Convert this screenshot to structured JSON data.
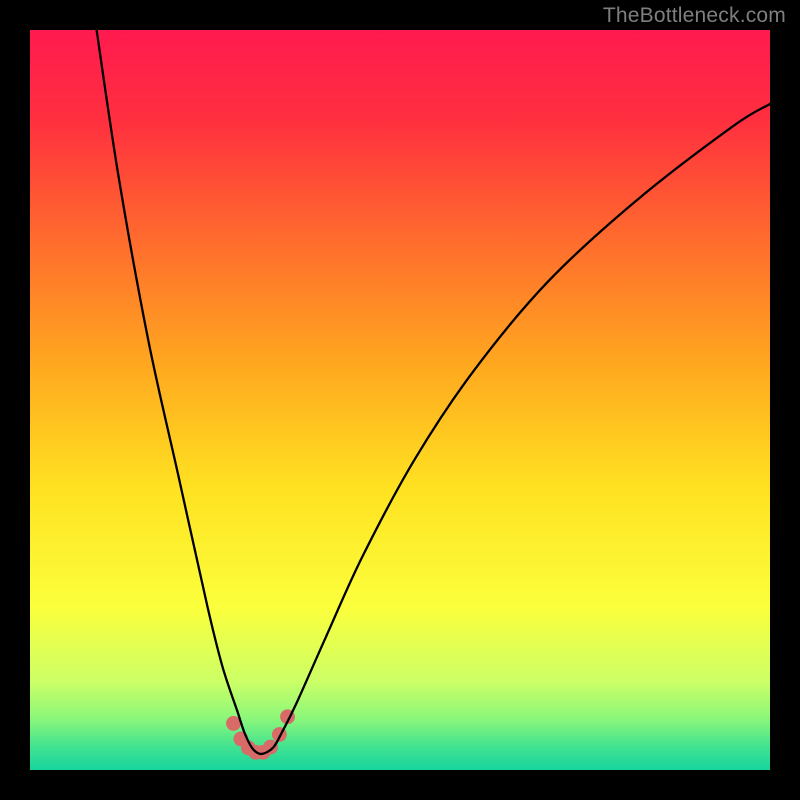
{
  "watermark": "TheBottleneck.com",
  "chart_data": {
    "type": "line",
    "title": "",
    "xlabel": "",
    "ylabel": "",
    "xlim": [
      0,
      100
    ],
    "ylim": [
      0,
      100
    ],
    "grid": false,
    "series": [
      {
        "name": "curve",
        "x": [
          9,
          12,
          16,
          20,
          24,
          26,
          28,
          29,
          30,
          31,
          32,
          33,
          34,
          36,
          40,
          45,
          52,
          60,
          70,
          82,
          95,
          100
        ],
        "y": [
          100,
          80,
          58,
          40,
          22,
          14,
          8,
          5,
          3,
          2.2,
          2.4,
          3.2,
          5,
          9,
          18,
          29,
          42,
          54,
          66,
          77,
          87,
          90
        ],
        "color": "#000000"
      }
    ],
    "bottom_dots": {
      "x": [
        27.5,
        28.5,
        29.5,
        30.5,
        31.5,
        32.5,
        33.7,
        34.8
      ],
      "y": [
        6.3,
        4.2,
        3.0,
        2.4,
        2.4,
        3.1,
        4.8,
        7.2
      ],
      "color": "#d86a67",
      "radius_pct": 1.0
    },
    "background_gradient": {
      "stops": [
        {
          "offset": 0.0,
          "color": "#ff1a4f"
        },
        {
          "offset": 0.12,
          "color": "#ff2f3f"
        },
        {
          "offset": 0.28,
          "color": "#ff6a2e"
        },
        {
          "offset": 0.45,
          "color": "#ffa71f"
        },
        {
          "offset": 0.62,
          "color": "#ffe221"
        },
        {
          "offset": 0.78,
          "color": "#fbff3c"
        },
        {
          "offset": 0.88,
          "color": "#ccff66"
        },
        {
          "offset": 0.93,
          "color": "#8cf77a"
        },
        {
          "offset": 0.97,
          "color": "#3fe291"
        },
        {
          "offset": 1.0,
          "color": "#17d49e"
        }
      ]
    }
  }
}
